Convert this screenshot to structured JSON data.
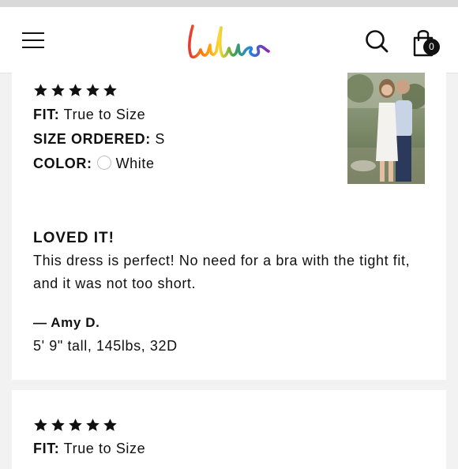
{
  "header": {
    "logo_text": "Lulus",
    "menu_icon": "hamburger-menu-icon",
    "search_icon": "search-icon",
    "bag_icon": "shopping-bag-icon",
    "bag_count": "0"
  },
  "reviews": [
    {
      "rating": 5,
      "fit_label": "FIT:",
      "fit_value": "True to Size",
      "size_label": "SIZE ORDERED:",
      "size_value": "S",
      "color_label": "COLOR:",
      "color_value": "White",
      "title": "LOVED IT!",
      "body": "This dress is perfect! No need for a bra with the tight fit, and it was not too short.",
      "author": "— Amy D.",
      "stats": "5' 9\" tall, 145lbs, 32D"
    },
    {
      "rating": 5,
      "fit_label": "FIT:",
      "fit_value": "True to Size"
    }
  ],
  "colors": {
    "page_bg": "#f2f2f2",
    "card_bg": "#ffffff",
    "text": "#111111"
  }
}
